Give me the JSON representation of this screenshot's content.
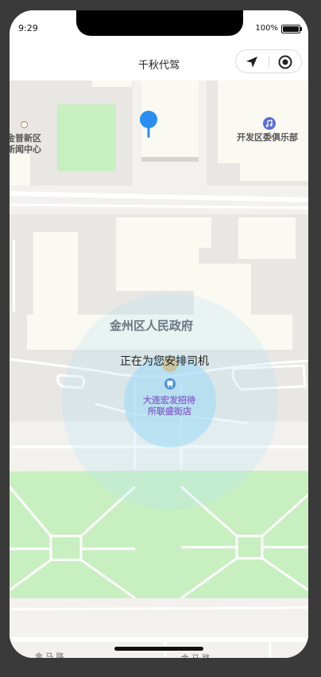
{
  "status": {
    "time": "9:29",
    "battery": "100%"
  },
  "nav": {
    "title": "千秋代驾"
  },
  "map": {
    "labels": {
      "gov": "金州区人民政府",
      "news_line1": "金普新区",
      "news_line2": "新闻中心",
      "club": "开发区委俱乐部",
      "hotel_line1": "大连宏发招待",
      "hotel_line2": "所联盛街店",
      "road_left": "金 马 路",
      "road_right": "金 马 路"
    },
    "searching_text": "正在为您安排司机"
  },
  "colors": {
    "accent": "#2a8ef0",
    "pulse": "#b7e3f5",
    "park": "#c8efc0",
    "road": "#ffffff",
    "block": "#e8e7e4",
    "building": "#fbfaf2"
  },
  "icons": [
    "location-pin-icon",
    "navigate-arrow-icon",
    "target-icon",
    "music-note-icon",
    "bus-stop-icon",
    "poi-dot-icon"
  ]
}
